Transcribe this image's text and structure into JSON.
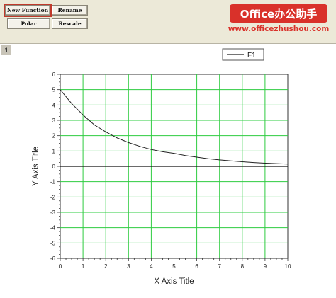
{
  "toolbar": {
    "new_function_label": "New Function",
    "rename_label": "Rename",
    "polar_label": "Polar",
    "rescale_label": "Rescale"
  },
  "banner": {
    "title": "Office办公助手",
    "url": "www.officezhushou.com"
  },
  "window_index": "1",
  "chart_data": {
    "type": "line",
    "title": "",
    "xlabel": "X Axis Title",
    "ylabel": "Y Axis Title",
    "xlim": [
      0,
      10
    ],
    "ylim": [
      -6,
      6
    ],
    "x_ticks": [
      "0",
      "1",
      "2",
      "3",
      "4",
      "5",
      "6",
      "7",
      "8",
      "9",
      "10"
    ],
    "y_ticks": [
      "-6",
      "-5",
      "-4",
      "-3",
      "-2",
      "-1",
      "0",
      "1",
      "2",
      "3",
      "4",
      "5",
      "6"
    ],
    "grid": true,
    "legend": "top-right",
    "series": [
      {
        "name": "F1",
        "x": [
          0,
          0.5,
          1,
          1.5,
          2,
          2.5,
          3,
          3.5,
          4,
          4.5,
          5,
          5.5,
          6,
          6.5,
          7,
          7.5,
          8,
          8.5,
          9,
          9.5,
          10
        ],
        "y": [
          5.0,
          4.1,
          3.35,
          2.7,
          2.25,
          1.85,
          1.55,
          1.3,
          1.1,
          0.95,
          0.85,
          0.7,
          0.6,
          0.5,
          0.42,
          0.36,
          0.3,
          0.25,
          0.21,
          0.18,
          0.15
        ]
      }
    ],
    "colors": {
      "grid": "#2ecc40",
      "line": "#222222",
      "zero_axis": "#111111"
    }
  }
}
